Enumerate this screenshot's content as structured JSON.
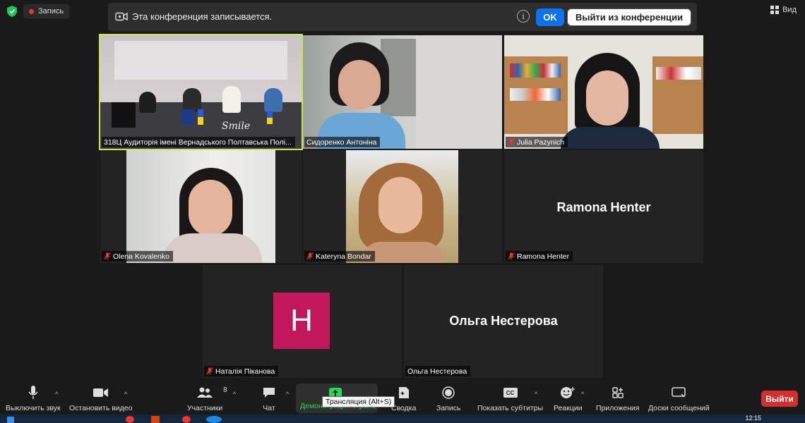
{
  "top": {
    "record_label": "Запись",
    "view_label": "Вид"
  },
  "banner": {
    "text": "Эта конференция записывается.",
    "ok_label": "OK",
    "leave_label": "Выйти из конференции"
  },
  "tiles": {
    "t1": {
      "name": "318Ц Аудиторія імені Вернадського Полтавська Полі...",
      "flag_text": "Smile"
    },
    "t2": {
      "name": "Сидоренко Антоніна"
    },
    "t3": {
      "name": "Julia Pazynich"
    },
    "t4": {
      "name": "Olena Kovalenko"
    },
    "t5": {
      "name": "Kateryna Bondar"
    },
    "t6": {
      "name": "Ramona Henter",
      "display": "Ramona Henter"
    },
    "t7": {
      "name": "Наталія Піканова",
      "avatar_letter": "H"
    },
    "t8": {
      "name": "Ольга Нестерова",
      "display": "Ольга Нестерова"
    }
  },
  "toolbar": {
    "mute": "Выключить звук",
    "video": "Остановить видео",
    "participants": "Участники",
    "participants_count": "8",
    "chat": "Чат",
    "share": "Демонстрация экрана",
    "summary": "Сводка",
    "record": "Запись",
    "captions": "Показать субтитры",
    "reactions": "Реакции",
    "apps": "Приложения",
    "whiteboards": "Доски сообщений",
    "exit": "Выйти",
    "tooltip": "Трансляция (Alt+S)"
  },
  "taskbar": {
    "time": "12:15"
  },
  "colors": {
    "accent_blue": "#0e72ed",
    "active_speaker": "#c8e65a",
    "exit_red": "#d32f2f",
    "avatar_pink": "#c2185b",
    "share_green": "#23d959"
  }
}
